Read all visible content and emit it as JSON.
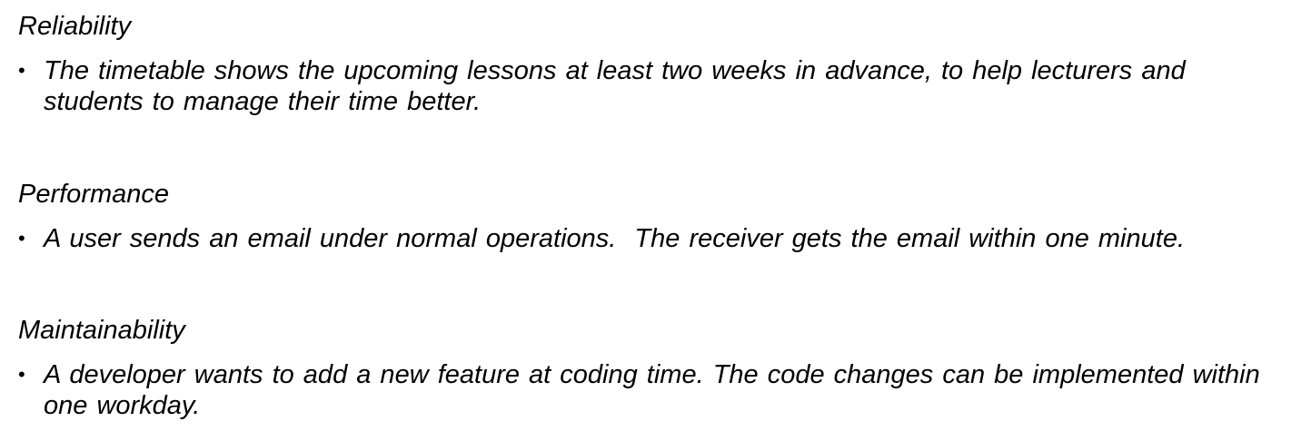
{
  "sections": [
    {
      "title": "Reliability",
      "bullets": [
        "The timetable shows the upcoming lessons at least two weeks in advance, to help lecturers and students to manage their time better."
      ]
    },
    {
      "title": "Performance",
      "bullets": [
        "A user sends an email under normal operations.  The receiver gets the email within one minute."
      ]
    },
    {
      "title": "Maintainability",
      "bullets": [
        "A developer wants to add a new feature at coding time. The code changes can be implemented within one workday."
      ]
    }
  ],
  "bullet_glyph": "•"
}
